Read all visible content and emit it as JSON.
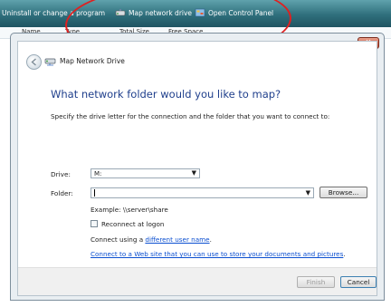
{
  "toolbar": {
    "uninstall_label": "Uninstall or change a program",
    "map_drive_label": "Map network drive",
    "control_panel_label": "Open Control Panel"
  },
  "columns": [
    "Name",
    "Type",
    "Total Size",
    "Free Space"
  ],
  "dialog": {
    "title": "Map Network Drive",
    "close_glyph": "✕",
    "heading": "What network folder would you like to map?",
    "instruction": "Specify the drive letter for the connection and the folder that you want to connect to:",
    "drive_label": "Drive:",
    "drive_value": "M:",
    "folder_label": "Folder:",
    "folder_value": "",
    "browse_label": "Browse...",
    "example": "Example: \\\\server\\share",
    "reconnect_label": "Reconnect at logon",
    "connect_using_prefix": "Connect using a ",
    "connect_using_link": "different user name",
    "connect_using_suffix": ".",
    "web_link": "Connect to a Web site that you can use to store your documents and pictures",
    "web_link_suffix": ".",
    "finish_label": "Finish",
    "cancel_label": "Cancel"
  },
  "colors": {
    "toolbar": "#2f6f7c",
    "heading": "#1f3f8c",
    "link": "#0b4fd0",
    "annotation": "#e02020"
  },
  "icons": [
    "map-drive-icon",
    "control-panel-icon",
    "back-arrow-icon",
    "network-drive-icon",
    "close-icon",
    "dropdown-arrow-icon"
  ]
}
